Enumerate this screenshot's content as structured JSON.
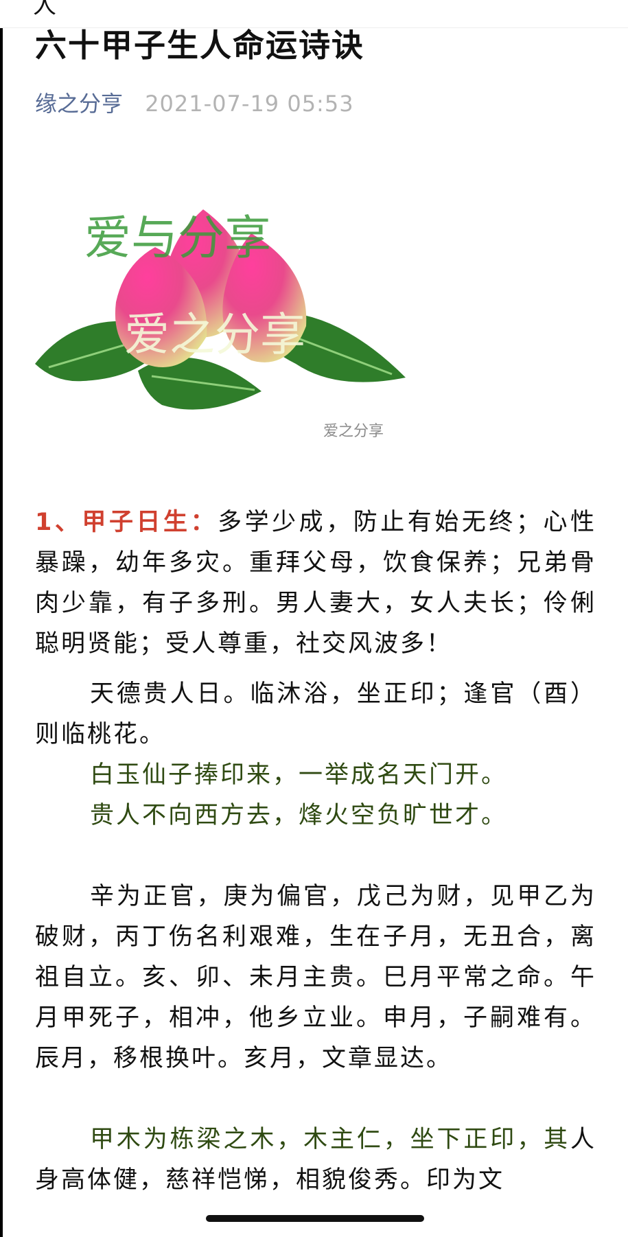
{
  "header": {
    "top_glyph": "人",
    "title": "六十甲子生人命运诗诀",
    "author": "缘之分亨",
    "date": "2021-07-19 05:53"
  },
  "hero_image": {
    "text_top": "爱与分享",
    "text_middle": "爱之分享",
    "watermark": "爱之分享",
    "colors": {
      "leaf": "#2f7d2a",
      "peach_pink": "#ee4c9a",
      "peach_yellow": "#dfe98a",
      "text_green": "#3a9a3a"
    }
  },
  "article": {
    "p1_label": "1、甲子日生：",
    "p1_text": "多学少成，防止有始无终；心性暴躁，幼年多灾。重拜父母，饮食保养；兄弟骨肉少靠，有子多刑。男人妻大，女人夫长；伶俐聪明贤能；受人尊重，社交风波多！",
    "p2_text": "天德贵人日。临沐浴，坐正印；逢官（酉）则临桃花。",
    "poem_line_1": "白玉仙子捧印来，一举成名天门开。",
    "poem_line_2": "贵人不向西方去，烽火空负旷世才。",
    "p3_text": "辛为正官，庚为偏官，戊己为财，见甲乙为破财，丙丁伤名利艰难，生在子月，无丑合，离祖自立。亥、卯、未月主贵。巳月平常之命。午月甲死子，相冲，他乡立业。申月，子嗣难有。辰月，移根换叶。亥月，文章显达。",
    "p4_green": "甲木为栋梁之木，木主仁，坐下正印，其",
    "p4_text": "人身高体健，慈祥恺悌，相貌俊秀。印为文"
  },
  "colors": {
    "label_red": "#d0402f",
    "poem_green": "#2f4a12",
    "author_blue": "#576b95",
    "date_gray": "#b3b3b3"
  }
}
